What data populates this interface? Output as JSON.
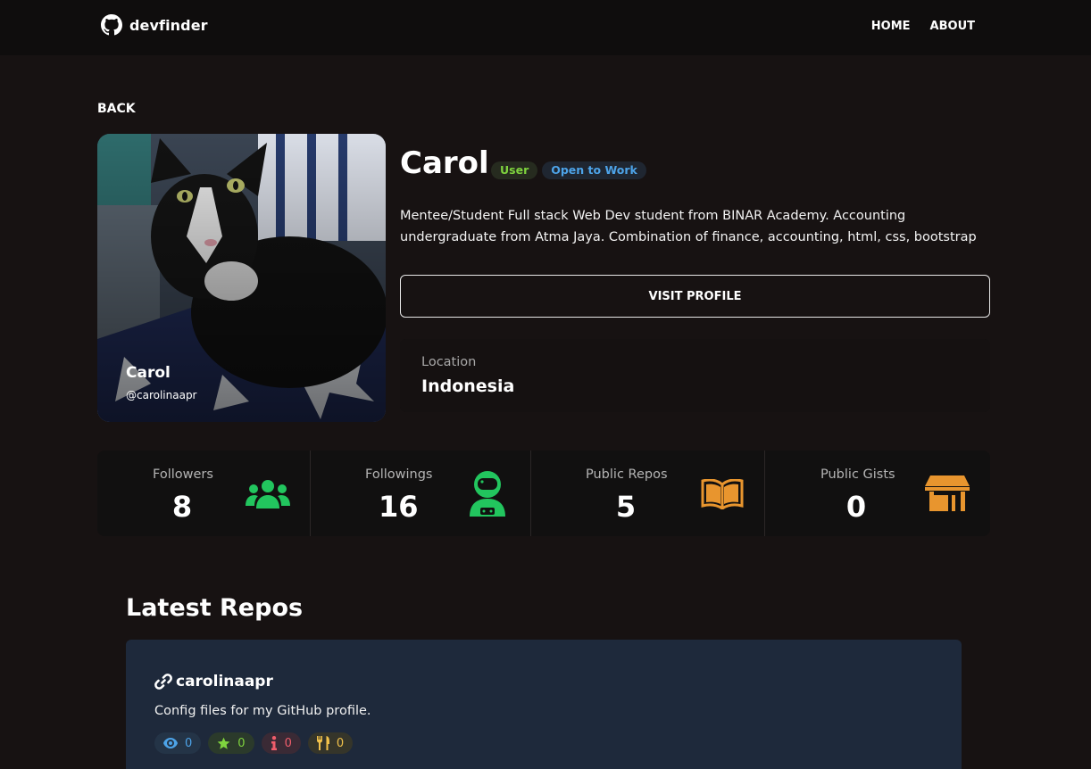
{
  "navbar": {
    "brand": "devfinder",
    "links": [
      "HOME",
      "ABOUT"
    ]
  },
  "back_label": "BACK",
  "profile": {
    "name": "Carol",
    "login": "@carolinaapr",
    "badges": [
      "User",
      "Open to Work"
    ],
    "bio": "Mentee/Student Full stack Web Dev student from BINAR Academy. Accounting undergraduate from Atma Jaya. Combination of finance, accounting, html, css, bootstrap",
    "visit_label": "VISIT PROFILE",
    "location_label": "Location",
    "location": "Indonesia"
  },
  "stats": [
    {
      "label": "Followers",
      "value": "8",
      "icon": "users-icon",
      "color": "#22c55e"
    },
    {
      "label": "Followings",
      "value": "16",
      "icon": "astronaut-icon",
      "color": "#22c55e"
    },
    {
      "label": "Public Repos",
      "value": "5",
      "icon": "book-open-icon",
      "color": "#e8952e"
    },
    {
      "label": "Public Gists",
      "value": "0",
      "icon": "store-icon",
      "color": "#e8952e"
    }
  ],
  "latest_repos": {
    "title": "Latest Repos",
    "items": [
      {
        "name": "carolinaapr",
        "description": "Config files for my GitHub profile.",
        "watchers": "0",
        "stars": "0",
        "issues": "0",
        "forks": "0"
      }
    ]
  }
}
